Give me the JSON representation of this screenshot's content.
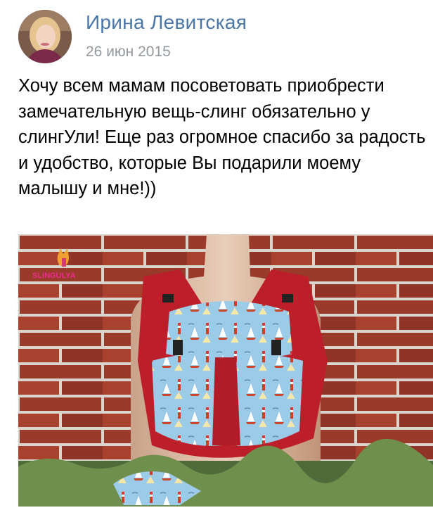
{
  "post": {
    "author_name": "Ирина Левитская",
    "date": "26 июн 2015",
    "text": "Хочу всем мамам посоветовать приобрести замечательную вещь-слинг обязательно у слингУли! Еще раз огромное спасибо за радость и удобство, которые Вы подарили моему малышу и мне!))"
  },
  "photo": {
    "watermark": "SLINGULYA",
    "subject": "ergo-backpack-carrier-red-with-sailboat-print"
  },
  "colors": {
    "author_link": "#4a76a8",
    "date_gray": "#93989d",
    "carrier_red": "#c0202a",
    "print_blue": "#8fc3e8"
  }
}
